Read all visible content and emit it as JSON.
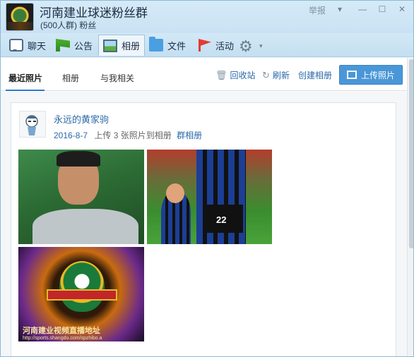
{
  "window": {
    "title": "河南建业球迷粉丝群",
    "subtitle": "(500人群) 粉丝",
    "report_label": "举报",
    "controls": {
      "menu": "▾",
      "minimize": "—",
      "maximize": "☐",
      "close": "✕"
    }
  },
  "toolbar": {
    "items": [
      {
        "label": "聊天",
        "icon": "chat-icon"
      },
      {
        "label": "公告",
        "icon": "announcement-flag-icon"
      },
      {
        "label": "相册",
        "icon": "photo-album-icon",
        "active": true
      },
      {
        "label": "文件",
        "icon": "folder-icon"
      },
      {
        "label": "活动",
        "icon": "activity-flag-icon"
      }
    ],
    "settings_icon": "⚙",
    "settings_caret": "▾"
  },
  "album": {
    "tabs": [
      {
        "label": "最近照片",
        "active": true
      },
      {
        "label": "相册"
      },
      {
        "label": "与我相关"
      }
    ],
    "actions": {
      "recycle_icon": "🗑",
      "recycle": "回收站",
      "refresh_icon": "↻",
      "refresh": "刷新",
      "create": "创建相册"
    },
    "upload_label": "上传照片"
  },
  "post": {
    "user_name": "永远的黄家驹",
    "date": "2016-8-7",
    "description": "上传 3 张照片到相册",
    "album_name": "群相册",
    "photos": [
      {
        "name": "photo-goalkeeper"
      },
      {
        "name": "photo-player-with-child",
        "jersey_number": "22"
      },
      {
        "name": "photo-club-logo",
        "caption": "河南建业视频直播地址",
        "url_text": "http://sports.shangdu.com/spzhibo.a"
      }
    ]
  },
  "colors": {
    "accent": "#2a68a8",
    "upload_button": "#4a97d8",
    "titlebar": "#d6eaf7"
  }
}
